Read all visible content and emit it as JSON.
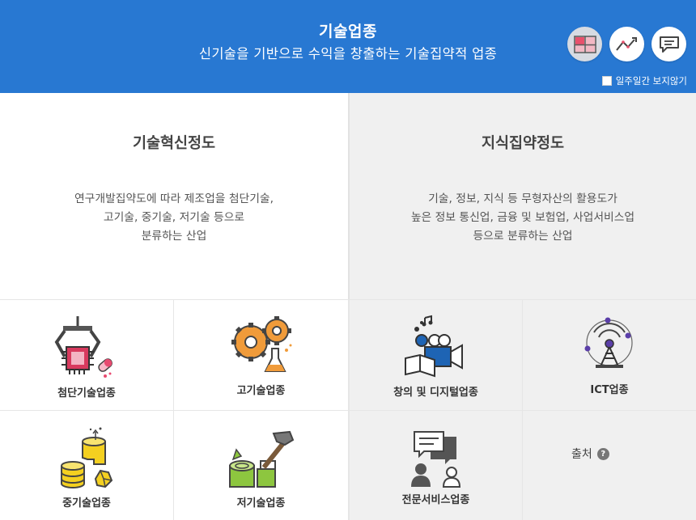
{
  "header": {
    "title": "기술업종",
    "subtitle": "신기술을 기반으로 수익을 창출하는 기술집약적 업종",
    "hide_week_label": "일주일간 보지않기",
    "buttons": [
      {
        "icon": "table-view-icon"
      },
      {
        "icon": "line-chart-icon"
      },
      {
        "icon": "comment-icon"
      }
    ]
  },
  "left_panel": {
    "title": "기술혁신정도",
    "desc": [
      "연구개발집약도에 따라 제조업을 첨단기술,",
      "고기술, 중기술, 저기술 등으로",
      "분류하는 산업"
    ]
  },
  "right_panel": {
    "title": "지식집약정도",
    "desc": [
      "기술, 정보, 지식 등 무형자산의 활용도가",
      "높은 정보 통신업, 금융 및 보험업, 사업서비스업",
      "등으로 분류하는 산업"
    ]
  },
  "categories": {
    "advanced": "첨단기술업종",
    "high": "고기술업종",
    "creative_digital": "창의 및 디지털업종",
    "ict": "ICT업종",
    "medium": "중기술업종",
    "low": "저기술업종",
    "professional_service": "전문서비스업종"
  },
  "source": {
    "label": "출처",
    "help": "?"
  }
}
